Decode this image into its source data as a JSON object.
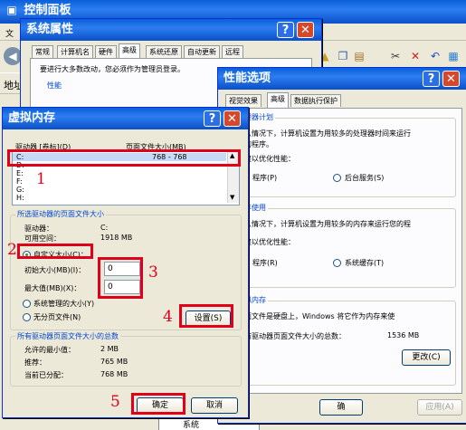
{
  "control_panel": {
    "title": "控制面板",
    "menu_fragment": "文",
    "address_label": "地址"
  },
  "system_properties": {
    "title": "系统属性",
    "tabs": [
      "常规",
      "计算机名",
      "硬件",
      "高级",
      "系统还原",
      "自动更新",
      "远程"
    ],
    "admin_note": "要进行大多数改动，您必须作为管理员登录。",
    "perf_group": "性能"
  },
  "perf_options": {
    "title": "性能选项",
    "tabs": [
      "视觉效果",
      "高级",
      "数据执行保护"
    ],
    "cpu": {
      "group": "处理器计划",
      "desc1": "默认情况下，计算机设置为用较多的处理器时间来运行",
      "desc2": "您的程序。",
      "adjust": "调整以优化性能：",
      "opt1": "程序(P)",
      "opt2": "后台服务(S)"
    },
    "mem": {
      "group": "内存使用",
      "desc": "默认情况下，计算机设置为用较多的内存来运行您的程",
      "adjust": "调整以优化性能：",
      "opt1": "程序(R)",
      "opt2": "系统缓存(T)"
    },
    "vmem": {
      "group": "虚拟内存",
      "desc1": "页面文件是硬盘上，Windows 将它作为内存来使",
      "desc2": "所有驱动器页面文件大小的总数：",
      "total": "1536 MB",
      "change_btn": "更改(C)"
    },
    "ok_fragment": "确",
    "apply_btn": "应用(A)"
  },
  "virtual_memory": {
    "title": "虚拟内存",
    "col_drive": "驱动器 [卷标](D)",
    "col_size": "页面文件大小(MB)",
    "drives": [
      "C:",
      "D:",
      "E:",
      "F:",
      "G:",
      "H:"
    ],
    "drive_c_size": "768 - 768",
    "selected_group": "所选驱动器的页面文件大小",
    "drive_label": "驱动器：",
    "drive_value": "C:",
    "space_label": "可用空间：",
    "space_value": "1918 MB",
    "custom_size": "自定义大小(C)：",
    "initial_label": "初始大小(MB)(I)：",
    "initial_value": "0",
    "max_label": "最大值(MB)(X)：",
    "max_value": "0",
    "system_managed": "系统管理的大小(Y)",
    "no_paging": "无分页文件(N)",
    "set_btn": "设置(S)",
    "total_group": "所有驱动器页面文件大小的总数",
    "min_label": "允许的最小值：",
    "min_value": "2 MB",
    "rec_label": "推荐：",
    "rec_value": "765 MB",
    "alloc_label": "当前已分配：",
    "alloc_value": "768 MB",
    "ok_btn": "确定",
    "cancel_btn": "取消"
  },
  "annotations": [
    "1",
    "2",
    "3",
    "4",
    "5"
  ],
  "taskbar_fragment": "系统",
  "colors": {
    "title_blue": "#0a5fd8",
    "dialog_bg": "#ece9d8",
    "highlight_red": "#e0001a"
  }
}
